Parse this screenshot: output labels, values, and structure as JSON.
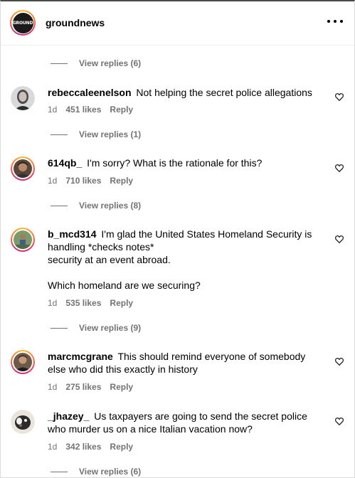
{
  "header": {
    "username": "groundnews",
    "logo_text": "GROUND"
  },
  "comments": [
    {
      "username": "rebeccaleenelson",
      "text": "Not helping the secret police allegations",
      "time": "1d",
      "likes": "451 likes",
      "reply": "Reply",
      "replies": "View replies (1)"
    },
    {
      "username": "614qb_",
      "text": "I'm sorry? What is the rationale for this?",
      "time": "1d",
      "likes": "710 likes",
      "reply": "Reply",
      "replies": "View replies (8)"
    },
    {
      "username": "b_mcd314",
      "text": "I'm glad the United States Homeland Security is handling *checks notes*\nsecurity at an event abroad.\n\nWhich homeland are we securing?",
      "time": "1d",
      "likes": "535 likes",
      "reply": "Reply",
      "replies": "View replies (9)"
    },
    {
      "username": "marcmcgrane",
      "text": "This should remind everyone of somebody else who did this exactly in history",
      "time": "1d",
      "likes": "275 likes",
      "reply": "Reply"
    },
    {
      "username": "_jhazey_",
      "text": "Us taxpayers are going to send the secret police who murder us on a nice Italian vacation now?",
      "time": "1d",
      "likes": "342 likes",
      "reply": "Reply",
      "replies": "View replies (6)"
    }
  ],
  "top_replies": "View replies (6)",
  "icons": {
    "more": "more-options-icon",
    "like": "heart-outline-icon"
  },
  "colors": {
    "secondary_text": "#737373",
    "story_ring_start": "#fdb836",
    "story_ring_end": "#c13584"
  }
}
